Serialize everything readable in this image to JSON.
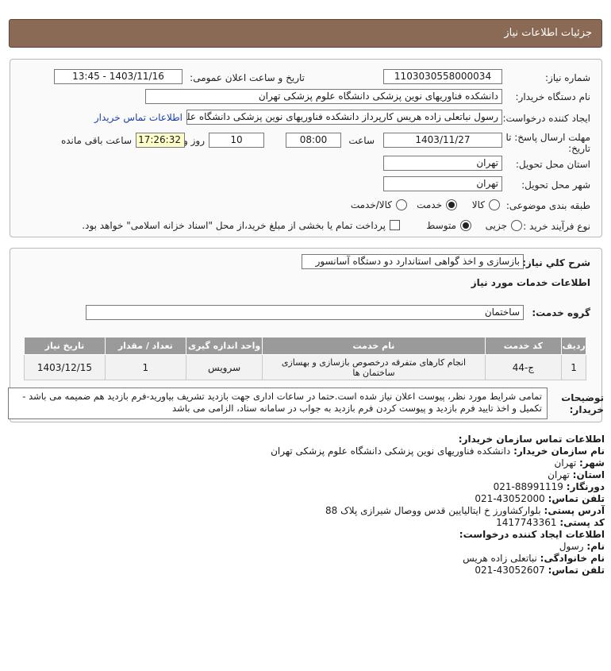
{
  "header": {
    "title": "جزئیات اطلاعات نیاز"
  },
  "form": {
    "need_number_label": "شماره نیاز:",
    "need_number": "1103030558000034",
    "announce_label": "تاریخ و ساعت اعلان عمومی:",
    "announce_value": "1403/11/16 - 13:45",
    "buyer_org_label": "نام دستگاه خریدار:",
    "buyer_org": "دانشکده فناوریهای نوین پزشکی دانشگاه علوم پزشکی تهران",
    "creator_label": "ایجاد کننده درخواست:",
    "creator": "رسول  نباتعلی زاده هریس کارپرداز دانشکده فناوریهای نوین پزشکی دانشگاه علوم پزشکی تهران",
    "contact_link": "اطلاعات تماس خریدار",
    "deadline_label_1": "مهلت ارسال پاسخ: تا",
    "deadline_label_2": "تاریخ:",
    "deadline_date": "1403/11/27",
    "time_label": "ساعت",
    "deadline_time": "08:00",
    "days_value": "10",
    "days_label": "روز و",
    "remaining_time": "17:26:32",
    "remaining_label": "ساعت باقی مانده",
    "province_label": "استان محل تحویل:",
    "province": "تهران",
    "city_label": "شهر محل تحویل:",
    "city": "تهران",
    "category_label": "طبقه بندی موضوعی:",
    "category_options": [
      "کالا",
      "خدمت",
      "کالا/خدمت"
    ],
    "category_selected": 1,
    "process_label": "نوع فرآیند خرید :",
    "process_options": [
      "جزیی",
      "متوسط"
    ],
    "process_selected": 1,
    "payment_note": "پرداخت تمام یا بخشی از مبلغ خرید،از محل \"اسناد خزانه اسلامی\" خواهد بود."
  },
  "need": {
    "summary_label": "شرح کلي نياز:",
    "summary": "بازسازی و اخذ گواهی استاندارد دو دستگاه آسانسور",
    "services_title": "اطلاعات خدمات مورد نیاز",
    "group_label": "گروه خدمت:",
    "group": "ساختمان",
    "table": {
      "headers": [
        "ردیف",
        "کد خدمت",
        "نام خدمت",
        "واحد اندازه گیری",
        "تعداد / مقدار",
        "تاریخ نیاز"
      ],
      "rows": [
        [
          "1",
          "ج-44",
          "انجام کارهای متفرقه درخصوص بازسازی و بهسازی ساختمان ها",
          "سرویس",
          "1",
          "1403/12/15"
        ]
      ]
    },
    "notes_label_1": "توضیحات",
    "notes_label_2": "خریدار:",
    "notes": "تمامی شرایط مورد نظر، پیوست اعلان نیاز شده است.حتما در ساعات اداری جهت بازدید تشریف بیاورید-فرم بازدید هم ضمیمه می باشد - تکمیل و اخذ تایید فرم بازدید و پیوست کردن فرم بازدید به جواب در سامانه ستاد، الزامی می باشد"
  },
  "buyer_contact": {
    "title": "اطلاعات تماس سازمان خریدار:",
    "org_label": "نام سازمان خریدار:",
    "org": "دانشکده فناوریهای نوین پزشکی دانشگاه علوم پزشکی تهران",
    "city_label": "شهر:",
    "city": "تهران",
    "province_label": "استان:",
    "province": "تهران",
    "fax_label": "دورنگار:",
    "fax": "88991119-021",
    "phone_label": "تلفن تماس:",
    "phone": "43052000-021",
    "address_label": "آدرس پستی:",
    "address": "بلوارکشاورز خ ایتالیایین قدس ووصال شیرازی پلاک 88",
    "postal_label": "کد پستی:",
    "postal": "1417743361"
  },
  "creator_contact": {
    "title": "اطلاعات ایجاد کننده درخواست:",
    "name_label": "نام:",
    "name": "رسول",
    "family_label": "نام خانوادگی:",
    "family": "نباتعلی زاده هریس",
    "phone_label": "تلفن تماس:",
    "phone": "43052607-021"
  },
  "colors": {
    "header_bg": "#8a6a55",
    "link": "#1f3fa6",
    "table_header": "#9a9a9a",
    "remaining_bg": "#ffffcc"
  }
}
